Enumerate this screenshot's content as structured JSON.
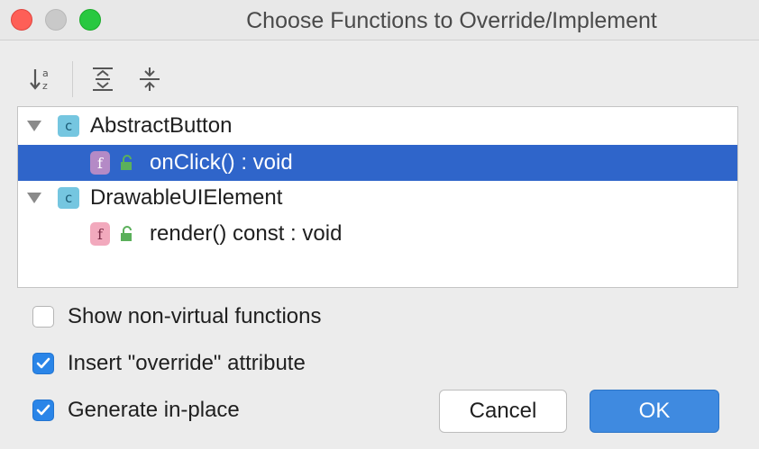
{
  "window": {
    "title": "Choose Functions to Override/Implement"
  },
  "toolbar": {
    "sort_icon": "sort-alphabetically-icon",
    "expand_icon": "expand-all-icon",
    "collapse_icon": "collapse-all-icon"
  },
  "tree": {
    "classes": [
      {
        "icon_letter": "c",
        "name": "AbstractButton",
        "functions": [
          {
            "icon_letter": "f",
            "signature": "onClick() : void",
            "selected": true
          }
        ]
      },
      {
        "icon_letter": "c",
        "name": "DrawableUIElement",
        "functions": [
          {
            "icon_letter": "f",
            "signature": "render() const : void",
            "selected": false
          }
        ]
      }
    ]
  },
  "options": {
    "show_non_virtual": {
      "label": "Show non-virtual functions",
      "checked": false
    },
    "insert_override": {
      "label": "Insert \"override\" attribute",
      "checked": true
    },
    "generate_in_place": {
      "label": "Generate in-place",
      "checked": true
    }
  },
  "buttons": {
    "cancel": "Cancel",
    "ok": "OK"
  },
  "colors": {
    "selection": "#2f65ca",
    "accent": "#3f8ae0",
    "class_icon": "#75c6e0",
    "function_icon": "#f2a9bd"
  }
}
